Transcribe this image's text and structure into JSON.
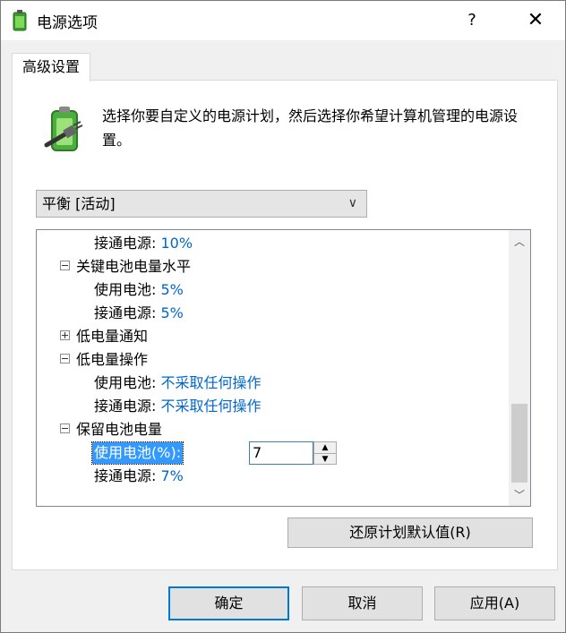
{
  "window": {
    "title": "电源选项",
    "help": "?",
    "close": "✕"
  },
  "tab": {
    "label": "高级设置"
  },
  "description": "选择你要自定义的电源计划，然后选择你希望计算机管理的电源设置。",
  "plan_select": {
    "value": "平衡 [活动]"
  },
  "tree": {
    "rows": [
      {
        "label": "接通电源:",
        "value": "10%"
      },
      {
        "label": "关键电池电量水平",
        "expander": "collapse"
      },
      {
        "label": "使用电池:",
        "value": "5%"
      },
      {
        "label": "接通电源:",
        "value": "5%"
      },
      {
        "label": "低电量通知",
        "expander": "expand"
      },
      {
        "label": "低电量操作",
        "expander": "collapse"
      },
      {
        "label": "使用电池:",
        "value": "不采取任何操作"
      },
      {
        "label": "接通电源:",
        "value": "不采取任何操作"
      },
      {
        "label": "保留电池电量",
        "expander": "collapse"
      },
      {
        "label": "使用电池(%):",
        "value": "7"
      },
      {
        "label": "接通电源:",
        "value": "7%"
      }
    ]
  },
  "buttons": {
    "restore": "还原计划默认值(R)",
    "ok": "确定",
    "cancel": "取消",
    "apply": "应用(A)"
  }
}
